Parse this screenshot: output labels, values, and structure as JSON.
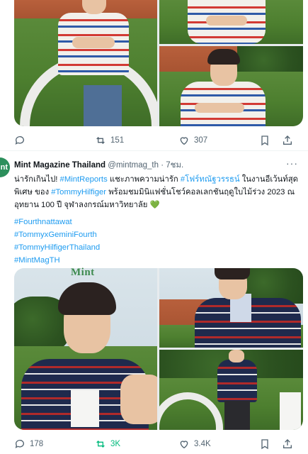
{
  "prev_post": {
    "stats": {
      "replies": "",
      "reposts": "151",
      "likes": "307"
    }
  },
  "tweet": {
    "author": {
      "display_name": "Mint Magazine Thailand",
      "handle": "@mintmag_th",
      "time": "· 7ชม.",
      "avatar_text": "nt"
    },
    "text": {
      "seg1": "น่ารักเกินไป! ",
      "seg2": "#MintReports",
      "seg3": " แชะภาพความน่ารัก ",
      "seg4": "#โฟร์ทณัฐวรรธน์",
      "seg5": " ในงานอีเว้นท์สุดพิเศษ ของ ",
      "seg6": "#TommyHilfiger",
      "seg7": " พร้อมชมมินิแฟชั่นโชว์คอลเลกชันฤดูใบไม้ร่วง 2023 ณ อุทยาน 100 ปี จุฬาลงกรณ์มหาวิทยาลัย 💚"
    },
    "hashtags": [
      "#Fourthnattawat",
      "#TommyxGeminiFourth",
      "#TommyHilfigerThailand",
      "#MintMagTH"
    ],
    "media_watermark": "Mint",
    "stats": {
      "replies": "178",
      "reposts": "3K",
      "likes": "3.4K"
    },
    "more_label": "···"
  },
  "icons": [
    "reply-icon",
    "repost-icon",
    "like-icon",
    "bookmark-icon",
    "share-icon"
  ],
  "colors": {
    "link": "#1d9bf0",
    "repost_active": "#00ba7c",
    "muted": "#536471"
  }
}
